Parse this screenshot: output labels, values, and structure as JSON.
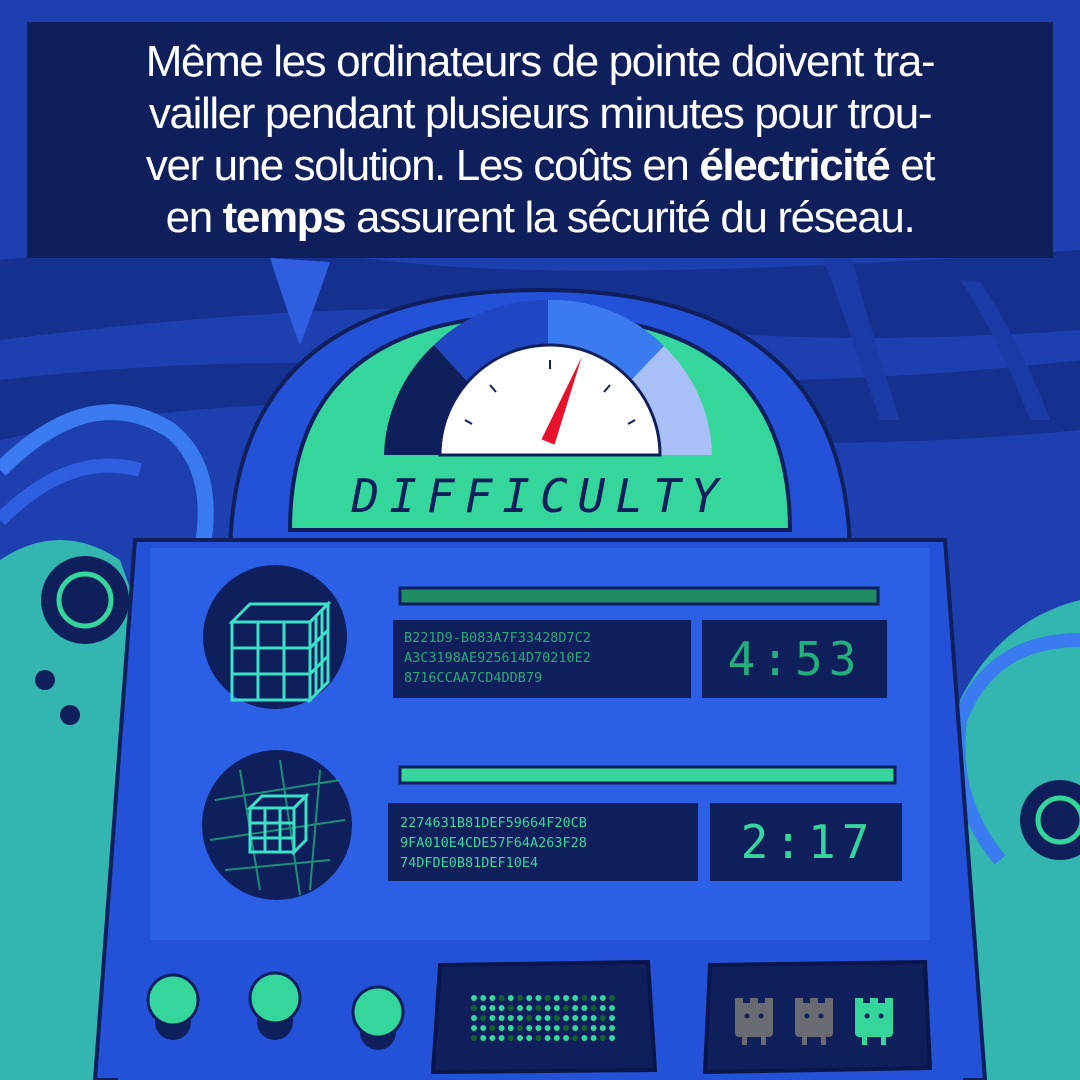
{
  "caption": {
    "line1": "Même les ordinateurs de pointe doivent tra-",
    "line2": "vailler pendant plusieurs minutes pour trou-",
    "line3": {
      "before": "ver une solution. Les coûts en ",
      "bold": "électricité",
      "after": " et"
    },
    "line4": {
      "before": "en ",
      "bold": "temps",
      "after": " assurent la sécurité du réseau."
    }
  },
  "gauge": {
    "label": "DIFFICULTY",
    "level": 0.62
  },
  "panel_top": {
    "hash_lines": [
      "B221D9-B083A7F33428D7C2",
      "A3C3198AE925614D70210E2",
      "8716CCAA7CD4DDB79"
    ],
    "timer": "4:53"
  },
  "panel_bottom": {
    "hash_lines": [
      "2274631B81DEF59664F20CB",
      "9FA010E4CDE57F64A263F28",
      "74DFDE0B81DEF10E4"
    ],
    "timer": "2:17"
  },
  "colors": {
    "background": "#1d3fb0",
    "caption_bg": "#0f1f5c",
    "accent_green": "#35d69b",
    "screen_bg": "#0f1f5c",
    "needle": "#e8102a"
  },
  "icons": [
    "cube-icon",
    "cube-grid-icon",
    "robot-icon"
  ]
}
